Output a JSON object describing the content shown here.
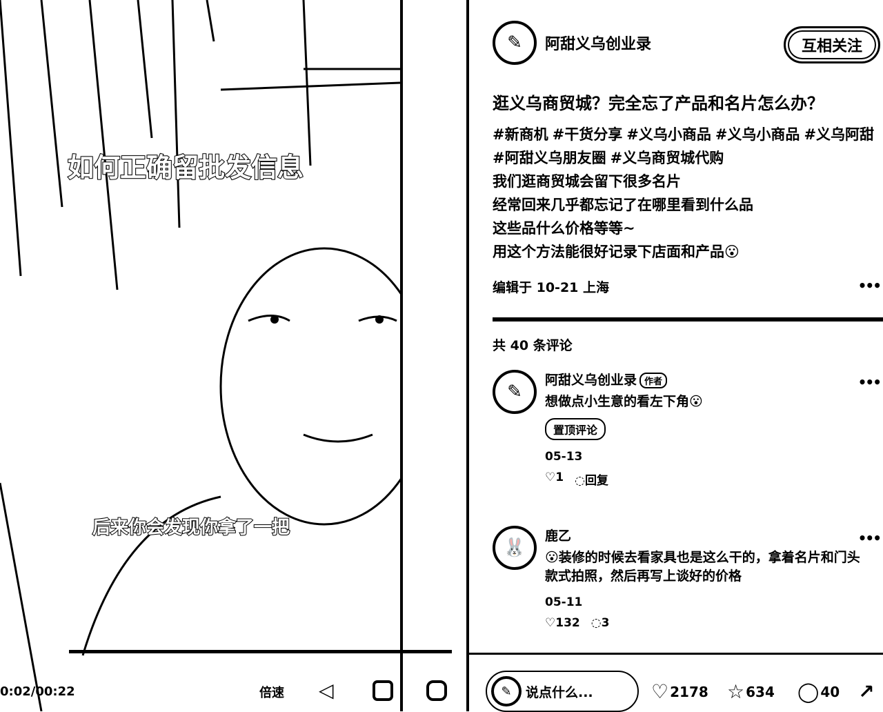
{
  "video": {
    "subtitle_top": "如何正确留批发信息",
    "subtitle_bottom": "后来你会发现你拿了一把",
    "time": "0:02/00:22",
    "speed_label": "倍速",
    "progress": 0.09
  },
  "author": {
    "name": "阿甜义乌创业录",
    "follow_label": "互相关注"
  },
  "post": {
    "title": "逛义乌商贸城？完全忘了产品和名片怎么办？",
    "tags": [
      "#新商机",
      "#干货分享",
      "#义乌小商品",
      "#义乌小商品",
      "#义乌阿甜",
      "#阿甜义乌朋友圈",
      "#义乌商贸城代购"
    ],
    "lines": [
      "我们逛商贸城会留下很多名片",
      "经常回来几乎都忘记了在哪里看到什么品",
      "这些品什么价格等等~",
      "用这个方法能很好记录下店面和产品😮"
    ],
    "meta": "编辑于 10-21 上海"
  },
  "comments_count": "共 40 条评论",
  "comments": [
    {
      "name": "阿甜义乌创业录",
      "badge": "作者",
      "text": "想做点小生意的看左下角😮",
      "pin": "置顶评论",
      "date": "05-13",
      "likes": "1",
      "reply": "回复"
    },
    {
      "name": "鹿乙",
      "text": "😮装修的时候去看家具也是这么干的，拿着名片和门头款式拍照，然后再写上谈好的价格",
      "date": "05-11",
      "likes": "132",
      "replies": "3"
    }
  ],
  "bottom": {
    "placeholder": "说点什么...",
    "likes": "2178",
    "stars": "634",
    "comments": "40"
  }
}
